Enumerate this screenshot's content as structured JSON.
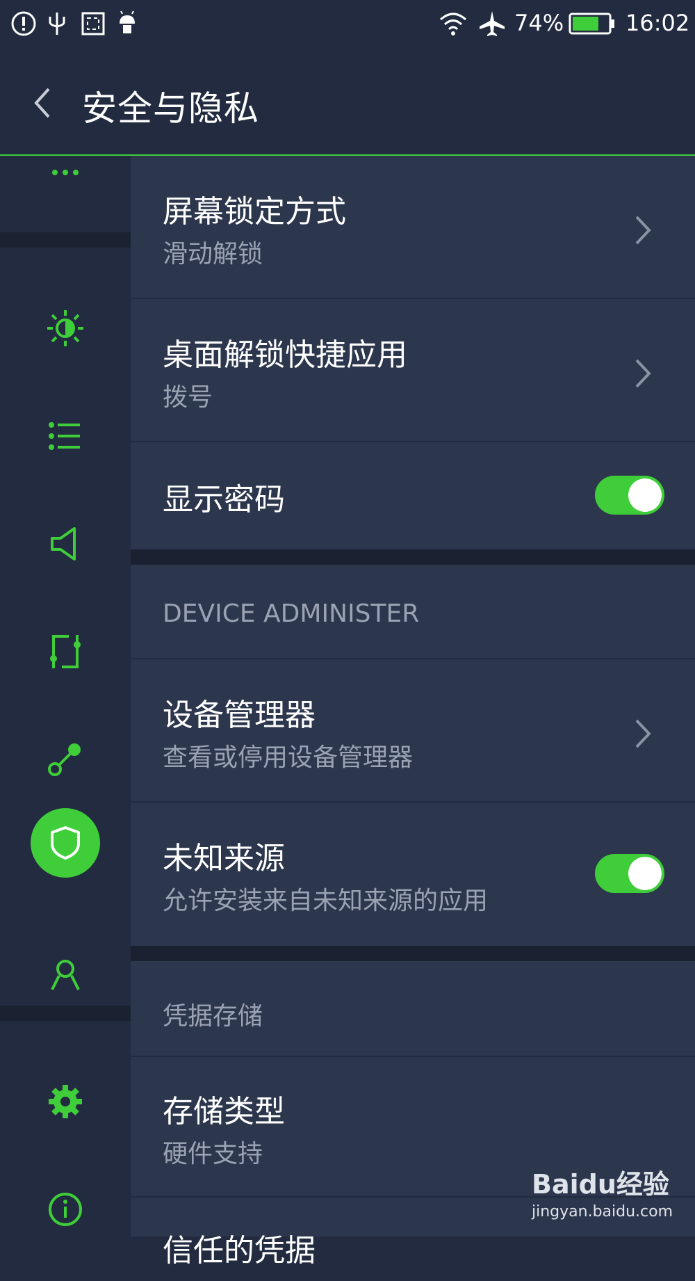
{
  "status_bar": {
    "battery_percent": "74%",
    "time": "16:02",
    "icons": [
      "alert-icon",
      "usb-icon",
      "screenshot-icon",
      "android-debug-icon",
      "wifi-icon",
      "airplane-icon",
      "battery-icon"
    ],
    "battery_level": 0.74
  },
  "header": {
    "title": "安全与隐私"
  },
  "sidebar": {
    "items": [
      {
        "icon": "more-icon"
      },
      {
        "icon": "display-brightness-icon"
      },
      {
        "icon": "notification-list-icon"
      },
      {
        "icon": "sound-icon"
      },
      {
        "icon": "gesture-icon"
      },
      {
        "icon": "connection-icon"
      },
      {
        "icon": "shield-icon",
        "active": true
      },
      {
        "icon": "account-icon"
      },
      {
        "icon": "settings-gear-icon"
      },
      {
        "icon": "info-icon"
      }
    ]
  },
  "content": {
    "screen_lock": {
      "title": "屏幕锁定方式",
      "value": "滑动解锁"
    },
    "desktop_unlock_app": {
      "title": "桌面解锁快捷应用",
      "value": "拨号"
    },
    "show_password": {
      "title": "显示密码",
      "enabled": true
    },
    "section_device_admin": "DEVICE ADMINISTER",
    "device_manager": {
      "title": "设备管理器",
      "value": "查看或停用设备管理器"
    },
    "unknown_sources": {
      "title": "未知来源",
      "value": "允许安装来自未知来源的应用",
      "enabled": true
    },
    "section_credentials": "凭据存储",
    "storage_type": {
      "title": "存储类型",
      "value": "硬件支持"
    },
    "trusted_credentials": {
      "title": "信任的凭据"
    }
  },
  "watermark": {
    "brand": "Baidu经验",
    "url": "jingyan.baidu.com"
  },
  "colors": {
    "accent": "#3fce3a",
    "background": "#222b3f",
    "panel": "#2c364c",
    "subtext": "#9aa2b3"
  }
}
